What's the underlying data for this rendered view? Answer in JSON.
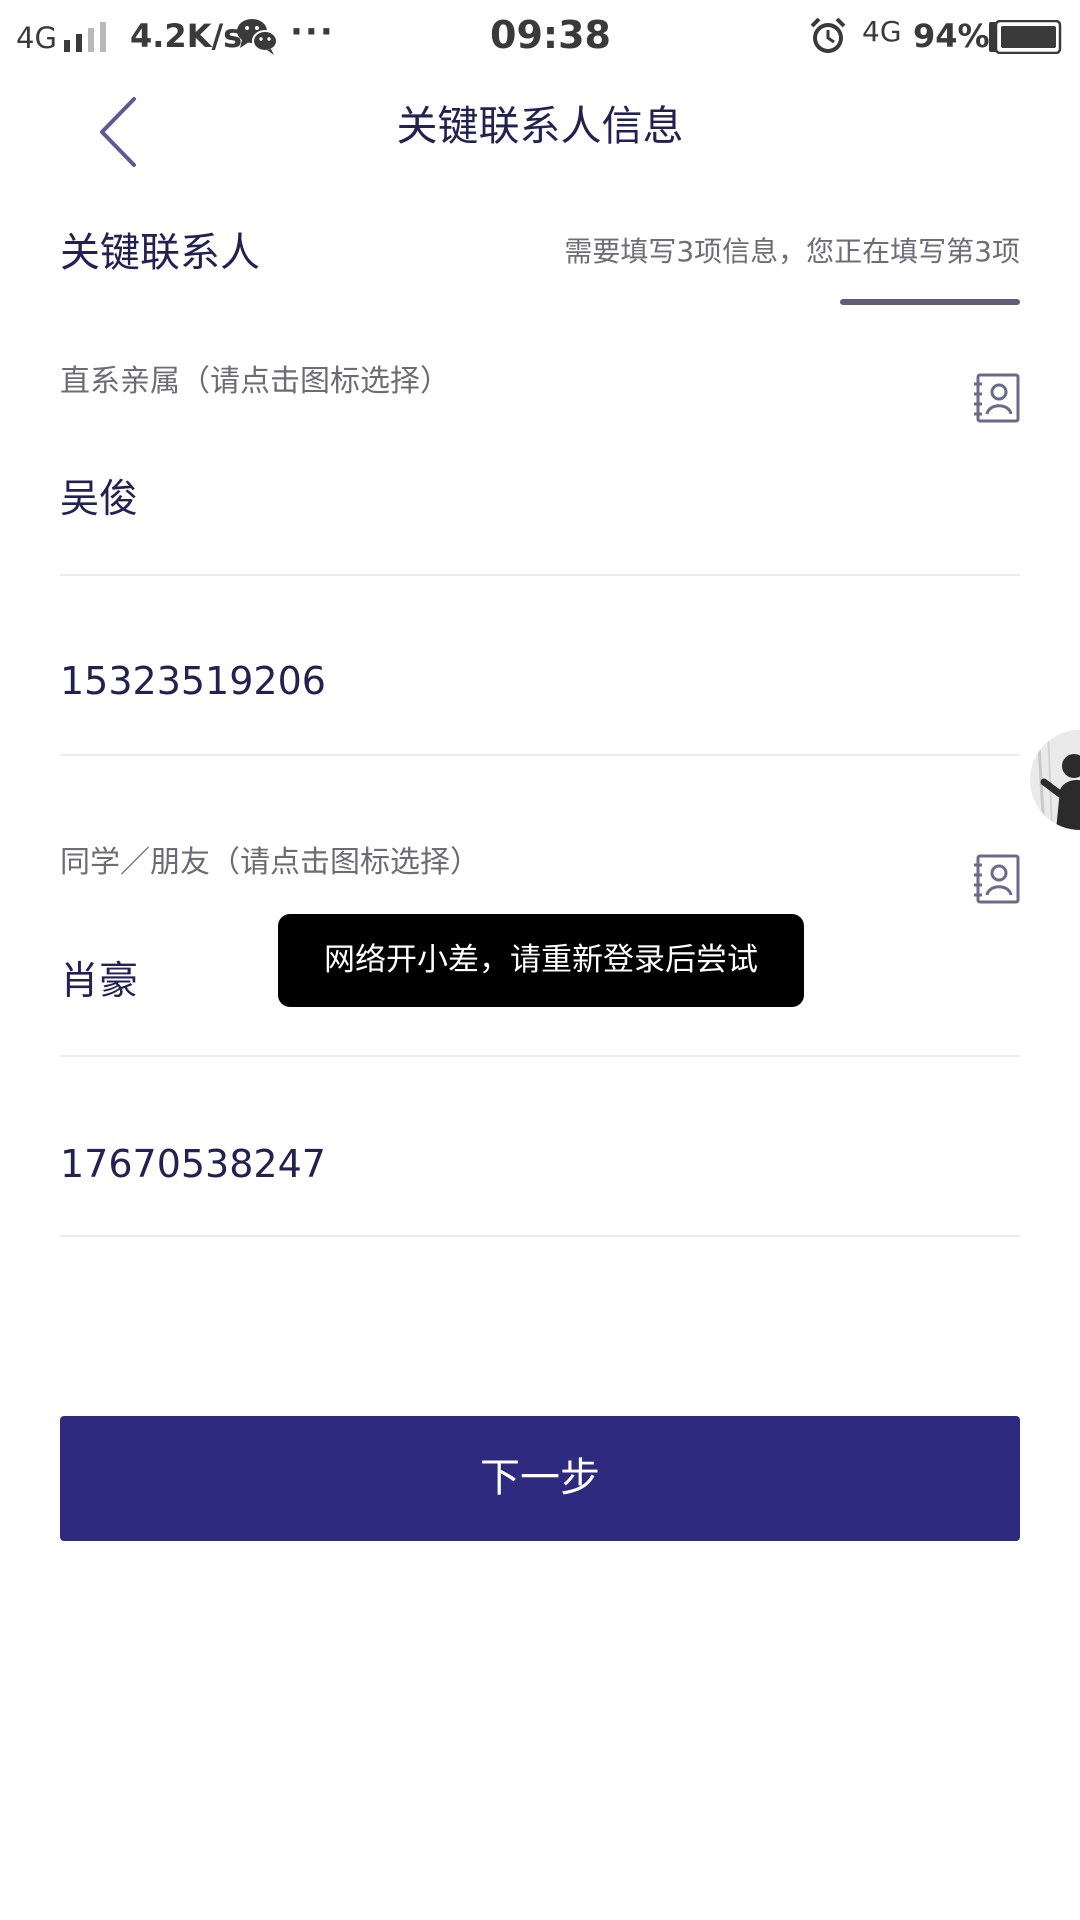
{
  "status_bar": {
    "network": "4G",
    "speed": "4.2K/s",
    "more": "···",
    "time": "09:38",
    "network_right": "4G",
    "battery": "94%"
  },
  "header": {
    "title": "关键联系人信息"
  },
  "section": {
    "title": "关键联系人",
    "progress": "需要填写3项信息，您正在填写第3项"
  },
  "contacts": [
    {
      "label": "直系亲属（请点击图标选择）",
      "name": "吴俊",
      "phone": "15323519206"
    },
    {
      "label": "同学／朋友（请点击图标选择）",
      "name": "肖豪",
      "phone": "17670538247"
    }
  ],
  "toast": {
    "message": "网络开小差，请重新登录后尝试"
  },
  "actions": {
    "next_label": "下一步"
  },
  "colors": {
    "primary": "#2d2a7f",
    "text": "#232152",
    "label": "#6c6c75",
    "divider": "#ececef"
  }
}
